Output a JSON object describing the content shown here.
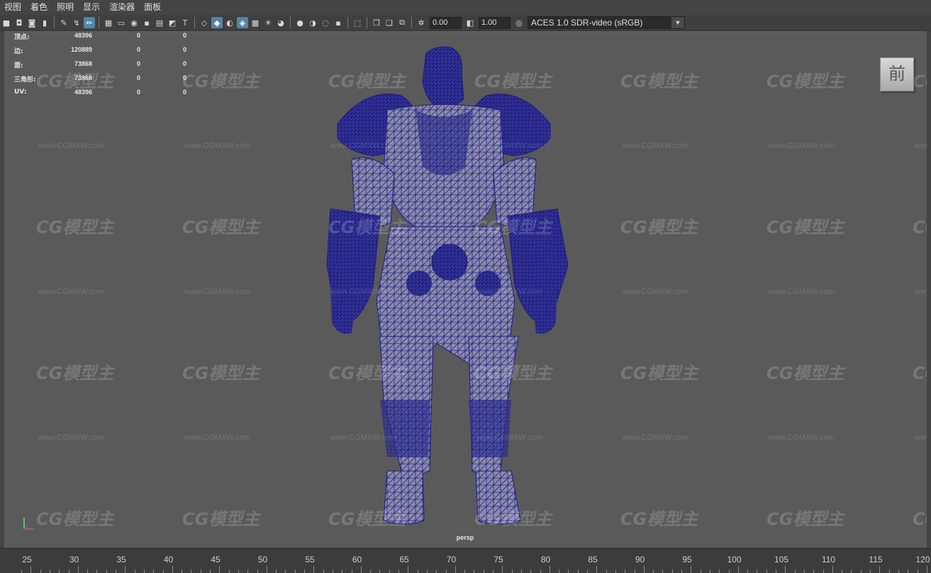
{
  "menu": [
    "视图",
    "着色",
    "照明",
    "显示",
    "渲染器",
    "面板"
  ],
  "toolbar": {
    "exposure_value": "0.00",
    "gamma_value": "1.00",
    "color_space": "ACES 1.0 SDR-video (sRGB)",
    "icons": [
      "camera-icon",
      "camera-attr-icon",
      "bookmark-icon",
      "image-plane-icon",
      "grid-icon",
      "film-gate-icon",
      "resolution-gate-icon",
      "safe-action-icon",
      "wireframe-icon",
      "smooth-shade-icon",
      "textured-icon",
      "lighting-icon",
      "shadows-icon",
      "ambient-occlusion-icon",
      "isolate-icon",
      "xray-icon",
      "xray-joints-icon",
      "exposure-icon",
      "gamma-icon",
      "colorspace-icon"
    ]
  },
  "hud": {
    "rows": [
      {
        "label": "顶点:",
        "v1": "48396",
        "v2": "0",
        "v3": "0"
      },
      {
        "label": "边:",
        "v1": "120889",
        "v2": "0",
        "v3": "0"
      },
      {
        "label": "面:",
        "v1": "73868",
        "v2": "0",
        "v3": "0"
      },
      {
        "label": "三角形:",
        "v1": "73868",
        "v2": "0",
        "v3": "0"
      },
      {
        "label": "UV:",
        "v1": "48396",
        "v2": "0",
        "v3": "0"
      }
    ]
  },
  "viewcube_label": "前",
  "camera_label": "persp",
  "watermark": {
    "logo": "CG模型主",
    "url": "www.CGMXW.com"
  },
  "timeline": {
    "ticks": [
      "25",
      "30",
      "35",
      "40",
      "45",
      "50",
      "55",
      "60",
      "65",
      "70",
      "75",
      "80",
      "85",
      "90",
      "95",
      "100",
      "105",
      "110",
      "115",
      "120"
    ]
  },
  "colors": {
    "wireframe": "#1f1f8f",
    "mesh_fill": "#8a8aa8",
    "viewport_bg": "#5a5a5a"
  }
}
